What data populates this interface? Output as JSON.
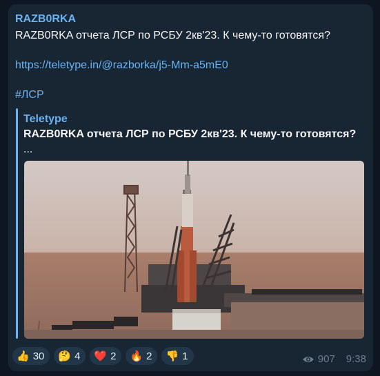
{
  "message": {
    "channel": "RAZB0RKA",
    "text": "RAZB0RKA отчета ЛСР по РСБУ 2кв'23. К чему-то готовятся?",
    "link": "https://teletype.in/@razborka/j5-Mm-a5mE0",
    "hashtag": "#ЛСР"
  },
  "preview": {
    "site": "Teletype",
    "title": "RAZB0RKA отчета ЛСР по РСБУ 2кв'23. К чему-то готовятся?",
    "ellipsis": "..."
  },
  "reactions": [
    {
      "emoji": "👍",
      "icon": "thumbs-up-icon",
      "count": "30"
    },
    {
      "emoji": "🤔",
      "icon": "thinking-face-icon",
      "count": "4"
    },
    {
      "emoji": "❤️",
      "icon": "heart-icon",
      "count": "2"
    },
    {
      "emoji": "🔥",
      "icon": "fire-icon",
      "count": "2"
    },
    {
      "emoji": "👎",
      "icon": "thumbs-down-icon",
      "count": "1"
    }
  ],
  "meta": {
    "views": "907",
    "time": "9:38"
  },
  "colors": {
    "background": "#0e1621",
    "bubble": "#182533",
    "accent": "#6ab3f3",
    "reaction_bg": "#223649",
    "meta": "#6d7f8f"
  }
}
